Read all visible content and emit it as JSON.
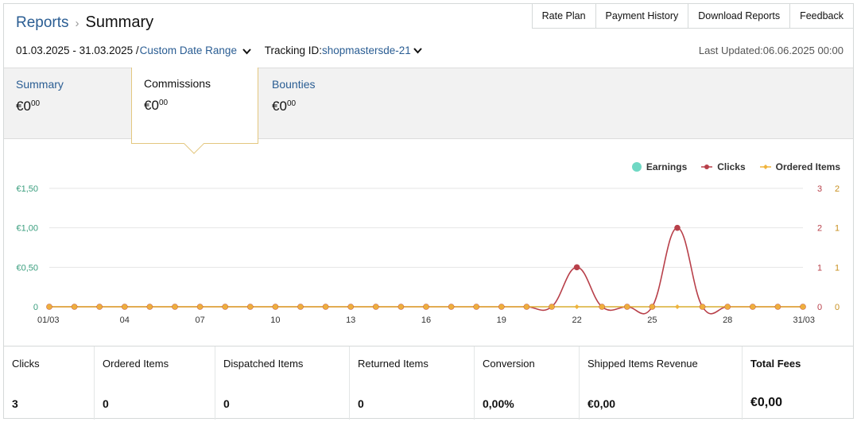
{
  "breadcrumb": {
    "parent": "Reports",
    "separator": "›",
    "current": "Summary"
  },
  "toplinks": [
    "Rate Plan",
    "Payment History",
    "Download Reports",
    "Feedback"
  ],
  "filters": {
    "date_range": "01.03.2025 - 31.03.2025 /",
    "range_type": "Custom Date Range",
    "tracking_label": "Tracking ID:",
    "tracking_id": "shopmastersde-21"
  },
  "last_updated": "Last Updated:06.06.2025 00:00",
  "tabs": [
    {
      "label": "Summary",
      "currency": "€",
      "whole": "0",
      "fraction": "00",
      "active": false
    },
    {
      "label": "Commissions",
      "currency": "€",
      "whole": "0",
      "fraction": "00",
      "active": true
    },
    {
      "label": "Bounties",
      "currency": "€",
      "whole": "0",
      "fraction": "00",
      "active": false
    }
  ],
  "legend": [
    {
      "name": "Earnings",
      "color": "#6fd8c4",
      "marker": "circle"
    },
    {
      "name": "Clicks",
      "color": "#b8404a",
      "marker": "dot-line"
    },
    {
      "name": "Ordered Items",
      "color": "#f0b43c",
      "marker": "diamond-line"
    }
  ],
  "chart_data": {
    "type": "line",
    "x_ticks": [
      "01/03",
      "04",
      "07",
      "10",
      "13",
      "16",
      "19",
      "22",
      "25",
      "28",
      "31/03"
    ],
    "y_left_ticks": [
      "€1,50",
      "€1,00",
      "€0,50",
      "0"
    ],
    "y_left_color": "#3a9e7e",
    "y_right_clicks_ticks": [
      "3",
      "2",
      "1",
      "0"
    ],
    "y_right_clicks_color": "#b8404a",
    "y_right_items_ticks": [
      "2",
      "1",
      "1",
      "0"
    ],
    "y_right_items_color": "#c89020",
    "x_days": [
      1,
      2,
      3,
      4,
      5,
      6,
      7,
      8,
      9,
      10,
      11,
      12,
      13,
      14,
      15,
      16,
      17,
      18,
      19,
      20,
      21,
      22,
      23,
      24,
      25,
      26,
      27,
      28,
      29,
      30,
      31
    ],
    "series": [
      {
        "name": "Earnings",
        "color": "#6fd8c4",
        "values": [
          0,
          0,
          0,
          0,
          0,
          0,
          0,
          0,
          0,
          0,
          0,
          0,
          0,
          0,
          0,
          0,
          0,
          0,
          0,
          0,
          0,
          0,
          0,
          0,
          0,
          0,
          0,
          0,
          0,
          0,
          0
        ]
      },
      {
        "name": "Clicks",
        "color": "#b8404a",
        "values": [
          0,
          0,
          0,
          0,
          0,
          0,
          0,
          0,
          0,
          0,
          0,
          0,
          0,
          0,
          0,
          0,
          0,
          0,
          0,
          0,
          0,
          1,
          0,
          0,
          0,
          2,
          0,
          0,
          0,
          0,
          0
        ]
      },
      {
        "name": "Ordered Items",
        "color": "#f0b43c",
        "values": [
          0,
          0,
          0,
          0,
          0,
          0,
          0,
          0,
          0,
          0,
          0,
          0,
          0,
          0,
          0,
          0,
          0,
          0,
          0,
          0,
          0,
          0,
          0,
          0,
          0,
          0,
          0,
          0,
          0,
          0,
          0
        ]
      }
    ],
    "y_left_range": [
      0,
      1.5
    ],
    "y_clicks_range": [
      0,
      3
    ],
    "grid": true
  },
  "metrics": [
    {
      "label": "Clicks",
      "value": "3",
      "bold": false
    },
    {
      "label": "Ordered Items",
      "value": "0",
      "bold": false
    },
    {
      "label": "Dispatched Items",
      "value": "0",
      "bold": false
    },
    {
      "label": "Returned Items",
      "value": "0",
      "bold": false
    },
    {
      "label": "Conversion",
      "value": "0,00%",
      "bold": false
    },
    {
      "label": "Shipped Items Revenue",
      "value": "€0,00",
      "bold": false
    },
    {
      "label": "Total Fees",
      "value": "€0,00",
      "bold": true
    }
  ]
}
